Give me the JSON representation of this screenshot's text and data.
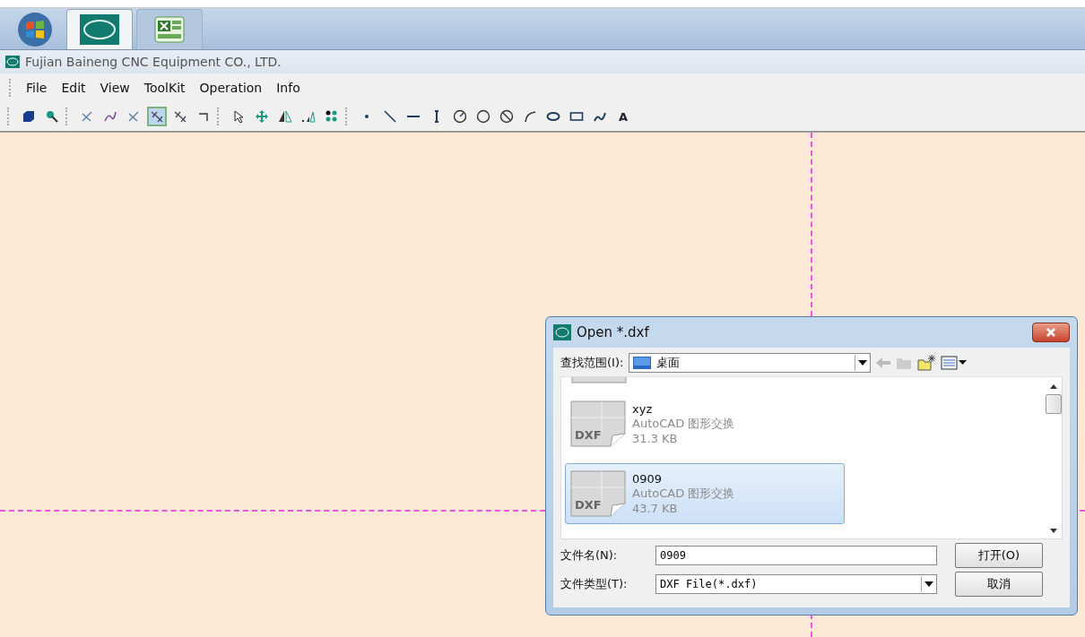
{
  "taskbar": {
    "items": [
      {
        "kind": "start"
      },
      {
        "kind": "app",
        "selected": true
      },
      {
        "kind": "spreadsheet",
        "selected": false
      }
    ]
  },
  "window": {
    "title": "Fujian Baineng CNC Equipment CO., LTD."
  },
  "menu": [
    "File",
    "Edit",
    "View",
    "ToolKit",
    "Operation",
    "Info"
  ],
  "toolbar": [
    [
      {
        "kind": "cube",
        "selected": false
      },
      {
        "kind": "zoom",
        "selected": false
      }
    ],
    [
      {
        "kind": "cross",
        "selected": false
      },
      {
        "kind": "curve",
        "selected": false
      },
      {
        "kind": "cross",
        "selected": false
      },
      {
        "kind": "cross-pair",
        "selected": true
      },
      {
        "kind": "cross-pair",
        "selected": false
      },
      {
        "kind": "corner",
        "selected": false
      }
    ],
    [
      {
        "kind": "pointer",
        "selected": false
      },
      {
        "kind": "move",
        "selected": false
      },
      {
        "kind": "mirror",
        "selected": false
      },
      {
        "kind": "scale",
        "selected": false
      },
      {
        "kind": "dots",
        "selected": false
      }
    ],
    [
      {
        "kind": "point",
        "selected": false
      },
      {
        "kind": "diagonal",
        "selected": false
      },
      {
        "kind": "hline",
        "selected": false
      },
      {
        "kind": "vline",
        "selected": false
      },
      {
        "kind": "circle-radius",
        "selected": false
      },
      {
        "kind": "circle",
        "selected": false
      },
      {
        "kind": "circle-slash",
        "selected": false
      },
      {
        "kind": "arc",
        "selected": false
      },
      {
        "kind": "ellipse",
        "selected": false
      },
      {
        "kind": "rect",
        "selected": false
      },
      {
        "kind": "spline",
        "selected": false
      },
      {
        "kind": "text",
        "label": "A",
        "selected": false
      }
    ]
  ],
  "dialog": {
    "title": "Open *.dxf",
    "look_in_label": "查找范围(I):",
    "look_in_value": "桌面",
    "files": [
      {
        "name": "xyz",
        "type": "AutoCAD 图形交换",
        "size": "31.3 KB",
        "icon_label": "DXF",
        "selected": false
      },
      {
        "name": "0909",
        "type": "AutoCAD 图形交换",
        "size": "43.7 KB",
        "icon_label": "DXF",
        "selected": true
      }
    ],
    "file_name_label": "文件名(N):",
    "file_name_value": "0909",
    "file_type_label": "文件类型(T):",
    "file_type_value": "DXF File(*.dxf)",
    "buttons": [
      "打开(O)",
      "取消"
    ]
  }
}
